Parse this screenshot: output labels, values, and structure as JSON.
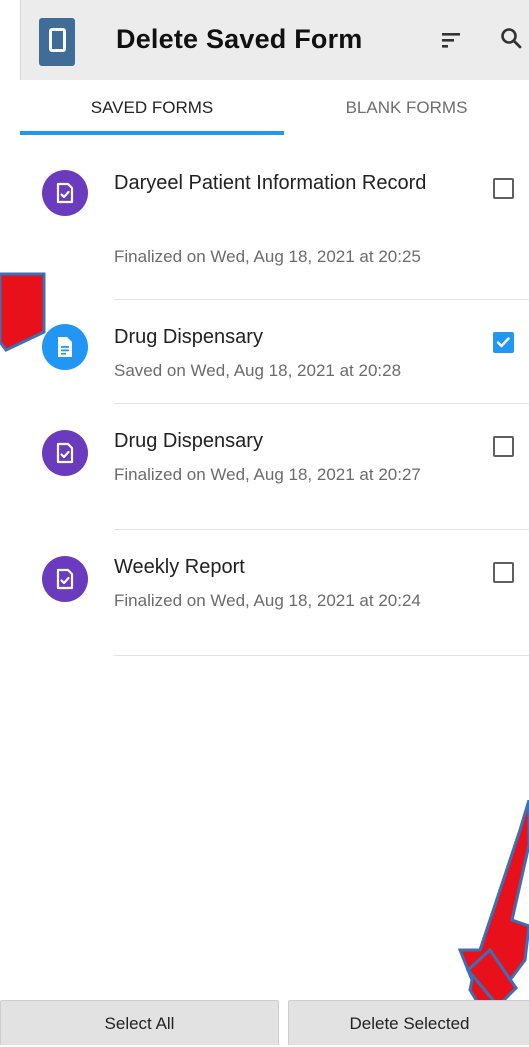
{
  "app": {
    "title": "Delete Saved Form",
    "icon": "app-logo-icon",
    "toolbar_icons": [
      "sort-icon",
      "search-icon"
    ]
  },
  "tabs": [
    {
      "label": "SAVED FORMS",
      "selected": true
    },
    {
      "label": "BLANK FORMS",
      "selected": false
    }
  ],
  "forms": [
    {
      "title": "Daryeel Patient Information Record",
      "subtitle": "Finalized on Wed, Aug 18, 2021 at 20:25",
      "status": "finalized",
      "icon": "finalized-form-icon",
      "checked": false
    },
    {
      "title": "Drug Dispensary",
      "subtitle": "Saved on Wed, Aug 18, 2021 at 20:28",
      "status": "saved",
      "icon": "saved-form-icon",
      "checked": true
    },
    {
      "title": "Drug Dispensary",
      "subtitle": "Finalized on Wed, Aug 18, 2021 at 20:27",
      "status": "finalized",
      "icon": "finalized-form-icon",
      "checked": false
    },
    {
      "title": "Weekly Report",
      "subtitle": "Finalized on Wed, Aug 18, 2021 at 20:24",
      "status": "finalized",
      "icon": "finalized-form-icon",
      "checked": false
    }
  ],
  "actions": {
    "select_all": "Select All",
    "delete_selected": "Delete Selected"
  },
  "colors": {
    "accent": "#2196f3",
    "finalized_icon": "#6a3bbf",
    "saved_icon": "#2196f3",
    "annotation_arrow": "#e8111b"
  }
}
